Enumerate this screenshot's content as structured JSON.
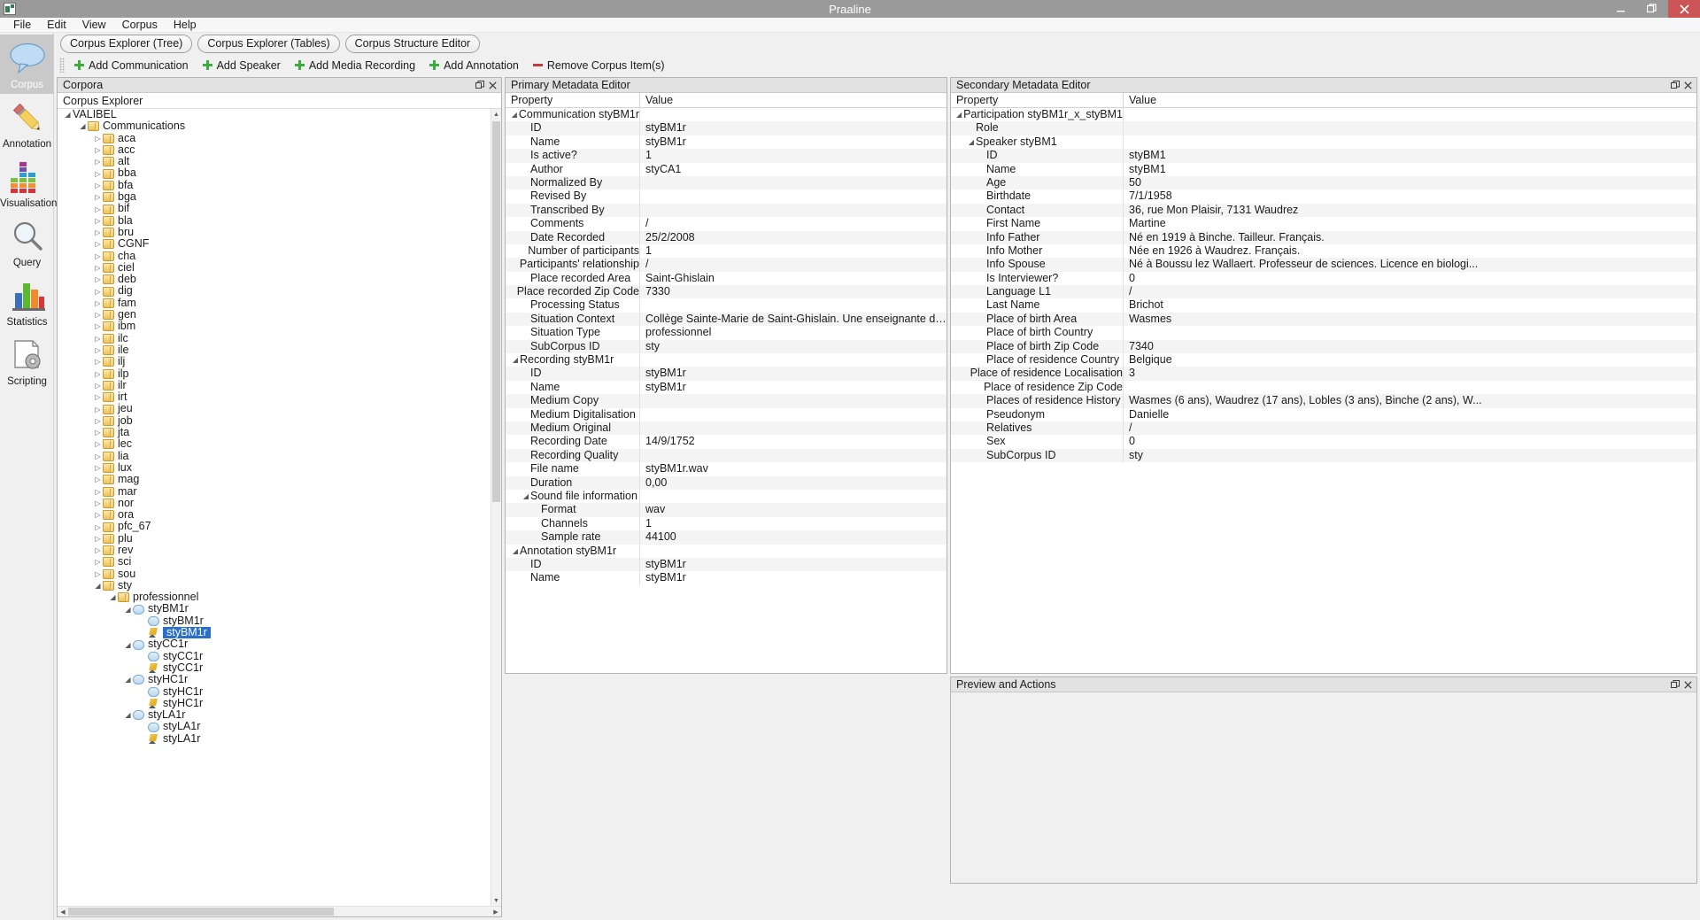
{
  "window": {
    "title": "Praaline",
    "minimize_label": "Minimize",
    "restore_label": "Restore",
    "close_label": "Close"
  },
  "menubar": [
    "File",
    "Edit",
    "View",
    "Corpus",
    "Help"
  ],
  "tabs": [
    "Corpus Explorer (Tree)",
    "Corpus Explorer (Tables)",
    "Corpus Structure Editor"
  ],
  "toolbar": [
    {
      "label": "Add Communication",
      "icon": "plus-icon"
    },
    {
      "label": "Add Speaker",
      "icon": "plus-icon"
    },
    {
      "label": "Add Media Recording",
      "icon": "plus-icon"
    },
    {
      "label": "Add Annotation",
      "icon": "plus-icon"
    },
    {
      "label": "Remove Corpus Item(s)",
      "icon": "minus-icon"
    }
  ],
  "modebar": [
    {
      "label": "Corpus",
      "icon": "speech-bubble-icon",
      "active": true
    },
    {
      "label": "Annotation",
      "icon": "pencil-icon",
      "active": false
    },
    {
      "label": "Visualisation",
      "icon": "equalizer-icon",
      "active": false
    },
    {
      "label": "Query",
      "icon": "magnifier-icon",
      "active": false
    },
    {
      "label": "Statistics",
      "icon": "bar-chart-icon",
      "active": false
    },
    {
      "label": "Scripting",
      "icon": "script-gear-icon",
      "active": false
    }
  ],
  "corpora_panel": {
    "title": "Corpora",
    "tree_header": "Corpus Explorer",
    "nodes": [
      {
        "label": "VALIBEL",
        "depth": 0,
        "arrow": "expanded",
        "icon": "none"
      },
      {
        "label": "Communications",
        "depth": 1,
        "arrow": "expanded",
        "icon": "folder"
      },
      {
        "label": "aca",
        "depth": 2,
        "arrow": "collapsed",
        "icon": "folder"
      },
      {
        "label": "acc",
        "depth": 2,
        "arrow": "collapsed",
        "icon": "folder"
      },
      {
        "label": "alt",
        "depth": 2,
        "arrow": "collapsed",
        "icon": "folder"
      },
      {
        "label": "bba",
        "depth": 2,
        "arrow": "collapsed",
        "icon": "folder"
      },
      {
        "label": "bfa",
        "depth": 2,
        "arrow": "collapsed",
        "icon": "folder"
      },
      {
        "label": "bga",
        "depth": 2,
        "arrow": "collapsed",
        "icon": "folder"
      },
      {
        "label": "bif",
        "depth": 2,
        "arrow": "collapsed",
        "icon": "folder"
      },
      {
        "label": "bla",
        "depth": 2,
        "arrow": "collapsed",
        "icon": "folder"
      },
      {
        "label": "bru",
        "depth": 2,
        "arrow": "collapsed",
        "icon": "folder"
      },
      {
        "label": "CGNF",
        "depth": 2,
        "arrow": "collapsed",
        "icon": "folder"
      },
      {
        "label": "cha",
        "depth": 2,
        "arrow": "collapsed",
        "icon": "folder"
      },
      {
        "label": "ciel",
        "depth": 2,
        "arrow": "collapsed",
        "icon": "folder"
      },
      {
        "label": "deb",
        "depth": 2,
        "arrow": "collapsed",
        "icon": "folder"
      },
      {
        "label": "dig",
        "depth": 2,
        "arrow": "collapsed",
        "icon": "folder"
      },
      {
        "label": "fam",
        "depth": 2,
        "arrow": "collapsed",
        "icon": "folder"
      },
      {
        "label": "gen",
        "depth": 2,
        "arrow": "collapsed",
        "icon": "folder"
      },
      {
        "label": "ibm",
        "depth": 2,
        "arrow": "collapsed",
        "icon": "folder"
      },
      {
        "label": "ilc",
        "depth": 2,
        "arrow": "collapsed",
        "icon": "folder"
      },
      {
        "label": "ile",
        "depth": 2,
        "arrow": "collapsed",
        "icon": "folder"
      },
      {
        "label": "ilj",
        "depth": 2,
        "arrow": "collapsed",
        "icon": "folder"
      },
      {
        "label": "ilp",
        "depth": 2,
        "arrow": "collapsed",
        "icon": "folder"
      },
      {
        "label": "ilr",
        "depth": 2,
        "arrow": "collapsed",
        "icon": "folder"
      },
      {
        "label": "irt",
        "depth": 2,
        "arrow": "collapsed",
        "icon": "folder"
      },
      {
        "label": "jeu",
        "depth": 2,
        "arrow": "collapsed",
        "icon": "folder"
      },
      {
        "label": "job",
        "depth": 2,
        "arrow": "collapsed",
        "icon": "folder"
      },
      {
        "label": "jta",
        "depth": 2,
        "arrow": "collapsed",
        "icon": "folder"
      },
      {
        "label": "lec",
        "depth": 2,
        "arrow": "collapsed",
        "icon": "folder"
      },
      {
        "label": "lia",
        "depth": 2,
        "arrow": "collapsed",
        "icon": "folder"
      },
      {
        "label": "lux",
        "depth": 2,
        "arrow": "collapsed",
        "icon": "folder"
      },
      {
        "label": "mag",
        "depth": 2,
        "arrow": "collapsed",
        "icon": "folder"
      },
      {
        "label": "mar",
        "depth": 2,
        "arrow": "collapsed",
        "icon": "folder"
      },
      {
        "label": "nor",
        "depth": 2,
        "arrow": "collapsed",
        "icon": "folder"
      },
      {
        "label": "ora",
        "depth": 2,
        "arrow": "collapsed",
        "icon": "folder"
      },
      {
        "label": "pfc_67",
        "depth": 2,
        "arrow": "collapsed",
        "icon": "folder"
      },
      {
        "label": "plu",
        "depth": 2,
        "arrow": "collapsed",
        "icon": "folder"
      },
      {
        "label": "rev",
        "depth": 2,
        "arrow": "collapsed",
        "icon": "folder"
      },
      {
        "label": "sci",
        "depth": 2,
        "arrow": "collapsed",
        "icon": "folder"
      },
      {
        "label": "sou",
        "depth": 2,
        "arrow": "collapsed",
        "icon": "folder"
      },
      {
        "label": "sty",
        "depth": 2,
        "arrow": "expanded",
        "icon": "folder"
      },
      {
        "label": "professionnel",
        "depth": 3,
        "arrow": "expanded",
        "icon": "folder"
      },
      {
        "label": "styBM1r",
        "depth": 4,
        "arrow": "expanded",
        "icon": "bubble"
      },
      {
        "label": "styBM1r",
        "depth": 5,
        "arrow": "none",
        "icon": "bubble"
      },
      {
        "label": "styBM1r",
        "depth": 5,
        "arrow": "none",
        "icon": "pencil",
        "selected": true
      },
      {
        "label": "styCC1r",
        "depth": 4,
        "arrow": "expanded",
        "icon": "bubble"
      },
      {
        "label": "styCC1r",
        "depth": 5,
        "arrow": "none",
        "icon": "bubble"
      },
      {
        "label": "styCC1r",
        "depth": 5,
        "arrow": "none",
        "icon": "pencil"
      },
      {
        "label": "styHC1r",
        "depth": 4,
        "arrow": "expanded",
        "icon": "bubble"
      },
      {
        "label": "styHC1r",
        "depth": 5,
        "arrow": "none",
        "icon": "bubble"
      },
      {
        "label": "styHC1r",
        "depth": 5,
        "arrow": "none",
        "icon": "pencil"
      },
      {
        "label": "styLA1r",
        "depth": 4,
        "arrow": "expanded",
        "icon": "bubble"
      },
      {
        "label": "styLA1r",
        "depth": 5,
        "arrow": "none",
        "icon": "bubble"
      },
      {
        "label": "styLA1r",
        "depth": 5,
        "arrow": "none",
        "icon": "pencil"
      }
    ]
  },
  "primary_metadata": {
    "title": "Primary Metadata Editor",
    "col_property": "Property",
    "col_value": "Value",
    "rows": [
      {
        "property": "Communication styBM1r",
        "value": "",
        "indent": 0,
        "group": true
      },
      {
        "property": "ID",
        "value": "styBM1r",
        "indent": 1
      },
      {
        "property": "Name",
        "value": "styBM1r",
        "indent": 1
      },
      {
        "property": "Is active?",
        "value": "1",
        "indent": 1
      },
      {
        "property": "Author",
        "value": "styCA1",
        "indent": 1
      },
      {
        "property": "Normalized By",
        "value": "",
        "indent": 1
      },
      {
        "property": "Revised By",
        "value": "",
        "indent": 1
      },
      {
        "property": "Transcribed By",
        "value": "",
        "indent": 1
      },
      {
        "property": "Comments",
        "value": "/",
        "indent": 1
      },
      {
        "property": "Date Recorded",
        "value": "25/2/2008",
        "indent": 1
      },
      {
        "property": "Number of participants",
        "value": "1",
        "indent": 1
      },
      {
        "property": "Participants' relationship",
        "value": "/",
        "indent": 1
      },
      {
        "property": "Place recorded Area",
        "value": "Saint-Ghislain",
        "indent": 1
      },
      {
        "property": "Place recorded Zip Code",
        "value": "7330",
        "indent": 1
      },
      {
        "property": "Processing Status",
        "value": "",
        "indent": 1
      },
      {
        "property": "Situation Context",
        "value": "Collège Sainte-Marie de Saint-Ghislain. Une enseignante donne un cours ma...",
        "indent": 1
      },
      {
        "property": "Situation Type",
        "value": "professionnel",
        "indent": 1
      },
      {
        "property": "SubCorpus ID",
        "value": "sty",
        "indent": 1
      },
      {
        "property": "Recording styBM1r",
        "value": "",
        "indent": 0,
        "group": true
      },
      {
        "property": "ID",
        "value": "styBM1r",
        "indent": 1
      },
      {
        "property": "Name",
        "value": "styBM1r",
        "indent": 1
      },
      {
        "property": "Medium Copy",
        "value": "",
        "indent": 1
      },
      {
        "property": "Medium Digitalisation",
        "value": "",
        "indent": 1
      },
      {
        "property": "Medium Original",
        "value": "",
        "indent": 1
      },
      {
        "property": "Recording Date",
        "value": "14/9/1752",
        "indent": 1
      },
      {
        "property": "Recording Quality",
        "value": "",
        "indent": 1
      },
      {
        "property": "File name",
        "value": "styBM1r.wav",
        "indent": 1
      },
      {
        "property": "Duration",
        "value": "0,00",
        "indent": 1
      },
      {
        "property": "Sound file information",
        "value": "",
        "indent": 1,
        "group": true
      },
      {
        "property": "Format",
        "value": "wav",
        "indent": 2
      },
      {
        "property": "Channels",
        "value": "1",
        "indent": 2
      },
      {
        "property": "Sample rate",
        "value": "44100",
        "indent": 2
      },
      {
        "property": "Annotation styBM1r",
        "value": "",
        "indent": 0,
        "group": true
      },
      {
        "property": "ID",
        "value": "styBM1r",
        "indent": 1
      },
      {
        "property": "Name",
        "value": "styBM1r",
        "indent": 1
      }
    ]
  },
  "secondary_metadata": {
    "title": "Secondary Metadata Editor",
    "col_property": "Property",
    "col_value": "Value",
    "rows": [
      {
        "property": "Participation styBM1r_x_styBM1",
        "value": "",
        "indent": 0,
        "group": true
      },
      {
        "property": "Role",
        "value": "",
        "indent": 1
      },
      {
        "property": "Speaker styBM1",
        "value": "",
        "indent": 1,
        "group": true
      },
      {
        "property": "ID",
        "value": "styBM1",
        "indent": 2
      },
      {
        "property": "Name",
        "value": "styBM1",
        "indent": 2
      },
      {
        "property": "Age",
        "value": "50",
        "indent": 2
      },
      {
        "property": "Birthdate",
        "value": "7/1/1958",
        "indent": 2
      },
      {
        "property": "Contact",
        "value": "36, rue Mon Plaisir, 7131 Waudrez",
        "indent": 2
      },
      {
        "property": "First Name",
        "value": "Martine",
        "indent": 2
      },
      {
        "property": "Info Father",
        "value": "Né en 1919 à Binche. Tailleur. Français.",
        "indent": 2
      },
      {
        "property": "Info Mother",
        "value": "Née en 1926 à Waudrez. Français.",
        "indent": 2
      },
      {
        "property": "Info Spouse",
        "value": "Né à Boussu lez Wallaert. Professeur de sciences. Licence en biologi...",
        "indent": 2
      },
      {
        "property": "Is Interviewer?",
        "value": "0",
        "indent": 2
      },
      {
        "property": "Language L1",
        "value": "/",
        "indent": 2
      },
      {
        "property": "Last Name",
        "value": "Brichot",
        "indent": 2
      },
      {
        "property": "Place of birth Area",
        "value": "Wasmes",
        "indent": 2
      },
      {
        "property": "Place of birth Country",
        "value": "",
        "indent": 2
      },
      {
        "property": "Place of birth Zip Code",
        "value": "7340",
        "indent": 2
      },
      {
        "property": "Place of residence Country",
        "value": "Belgique",
        "indent": 2
      },
      {
        "property": "Place of residence Localisation",
        "value": "3",
        "indent": 2
      },
      {
        "property": "Place of residence Zip Code",
        "value": "",
        "indent": 2
      },
      {
        "property": "Places of residence History",
        "value": "Wasmes (6 ans), Waudrez (17 ans), Lobles (3 ans), Binche (2 ans), W...",
        "indent": 2
      },
      {
        "property": "Pseudonym",
        "value": "Danielle",
        "indent": 2
      },
      {
        "property": "Relatives",
        "value": "/",
        "indent": 2
      },
      {
        "property": "Sex",
        "value": "0",
        "indent": 2
      },
      {
        "property": "SubCorpus ID",
        "value": "sty",
        "indent": 2
      }
    ]
  },
  "preview_panel": {
    "title": "Preview and Actions"
  },
  "colors": {
    "selection": "#2a6fc9",
    "titlebar": "#9a9a9a",
    "close_button": "#cc5555",
    "add_icon": "#3faa3f",
    "remove_icon": "#c03b3b"
  }
}
